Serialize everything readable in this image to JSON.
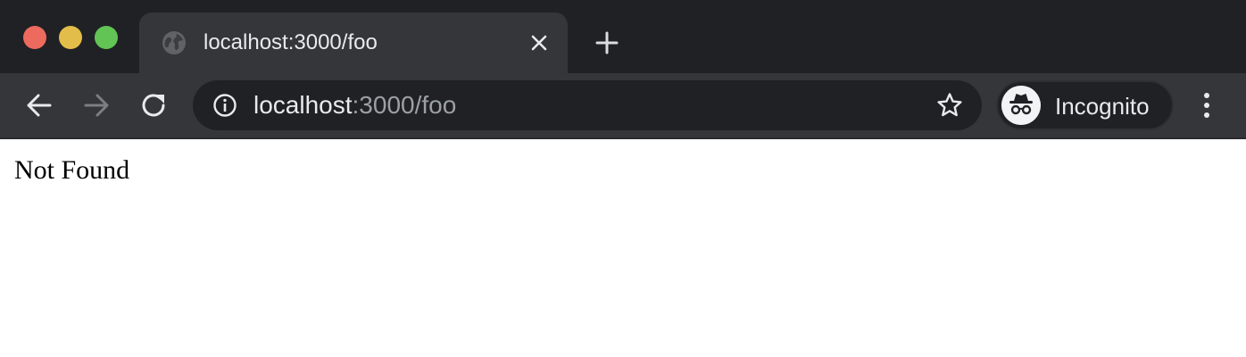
{
  "window_controls": {
    "close_color": "#ed6a5e",
    "minimize_color": "#e3bd49",
    "zoom_color": "#61c454"
  },
  "tab": {
    "title": "localhost:3000/foo",
    "favicon": "globe-icon",
    "close_icon": "close-icon"
  },
  "new_tab_icon": "plus-icon",
  "toolbar": {
    "back_icon": "arrow-left-icon",
    "forward_icon": "arrow-right-icon",
    "reload_icon": "reload-icon",
    "forward_enabled": false
  },
  "omnibox": {
    "info_icon": "info-icon",
    "host": "localhost",
    "path": ":3000/foo",
    "bookmark_icon": "star-icon"
  },
  "profile": {
    "label": "Incognito",
    "icon": "incognito-icon"
  },
  "menu_icon": "more-vertical-icon",
  "content": {
    "text": "Not Found"
  },
  "colors": {
    "tabstrip_bg": "#202124",
    "toolbar_bg": "#35363a",
    "text_primary": "#e8eaed",
    "text_secondary": "#9aa0a6"
  }
}
